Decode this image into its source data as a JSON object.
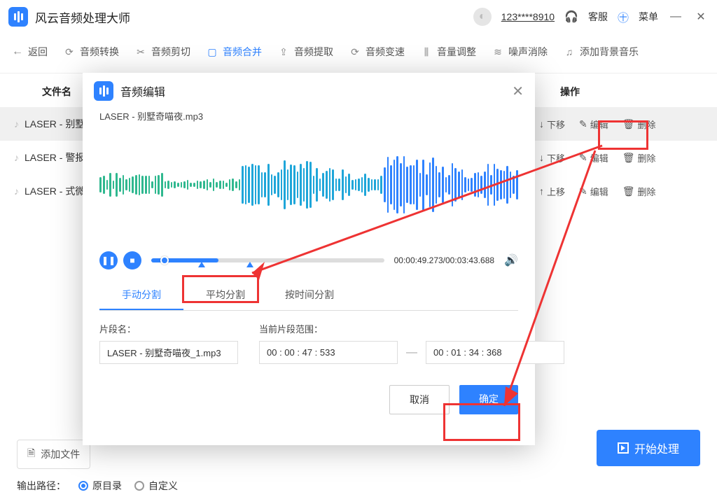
{
  "app": {
    "title": "风云音频处理大师",
    "user_id": "123****8910",
    "support": "客服",
    "menu": "菜单"
  },
  "toolbar": {
    "back": "返回",
    "items": [
      {
        "label": "音频转换"
      },
      {
        "label": "音频剪切"
      },
      {
        "label": "音频合并"
      },
      {
        "label": "音频提取"
      },
      {
        "label": "音频变速"
      },
      {
        "label": "音量调整"
      },
      {
        "label": "噪声消除"
      },
      {
        "label": "添加背景音乐"
      }
    ]
  },
  "columns": {
    "name": "文件名",
    "ops": "操作"
  },
  "files": [
    {
      "name": "LASER - 别墅",
      "move": "下移",
      "edit": "编辑",
      "del": "删除"
    },
    {
      "name": "LASER - 警报",
      "move": "下移",
      "edit": "编辑",
      "del": "删除"
    },
    {
      "name": "LASER - 式微",
      "move": "上移",
      "edit": "编辑",
      "del": "删除"
    }
  ],
  "bottom": {
    "add": "添加文件",
    "start": "开始处理",
    "output_label": "输出路径：",
    "opt_orig": "原目录",
    "opt_custom": "自定义"
  },
  "modal": {
    "title": "音频编辑",
    "filename": "LASER - 别墅奇喵夜.mp3",
    "time": "00:00:49.273/00:03:43.688",
    "tabs": {
      "manual": "手动分割",
      "avg": "平均分割",
      "bytime": "按时间分割"
    },
    "seg_name_label": "片段名：",
    "seg_name_value": "LASER - 别墅奇喵夜_1.mp3",
    "range_label": "当前片段范围：",
    "range_start": "00 : 00 : 47 : 533",
    "range_end": "00 : 01 : 34 : 368",
    "cancel": "取消",
    "ok": "确定"
  }
}
